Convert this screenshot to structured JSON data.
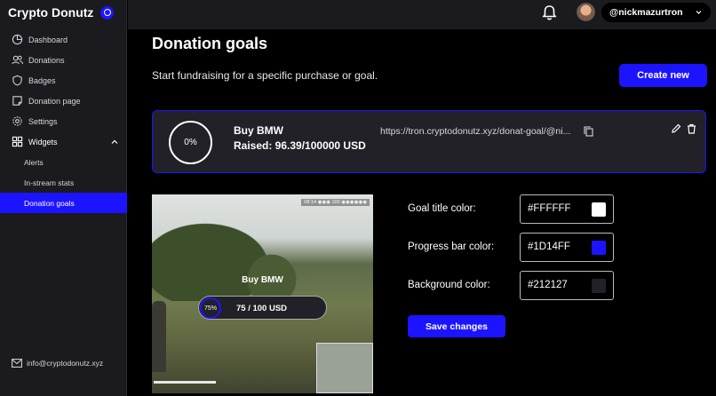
{
  "app": {
    "title": "Crypto Donutz"
  },
  "sidebar": {
    "items": [
      {
        "label": "Dashboard",
        "icon": "dashboard-icon"
      },
      {
        "label": "Donations",
        "icon": "users-icon"
      },
      {
        "label": "Badges",
        "icon": "shield-icon"
      },
      {
        "label": "Donation page",
        "icon": "page-icon"
      },
      {
        "label": "Settings",
        "icon": "gear-icon"
      },
      {
        "label": "Widgets",
        "icon": "grid-icon",
        "expanded": true
      }
    ],
    "widgets_sub": [
      {
        "label": "Alerts",
        "active": false
      },
      {
        "label": "In-stream stats",
        "active": false
      },
      {
        "label": "Donation goals",
        "active": true
      }
    ],
    "contact_email": "info@cryptodonutz.xyz"
  },
  "header": {
    "username": "@nickmazurtron"
  },
  "main": {
    "title": "Donation goals",
    "subtitle": "Start fundraising for a specific purchase or goal.",
    "create_label": "Create new",
    "goal": {
      "percent": "0%",
      "name": "Buy BMW",
      "raised": "Raised: 96.39/100000 USD",
      "url": "https://tron.cryptodonutz.xyz/donat-goal/@ni..."
    },
    "preview": {
      "hud_text": "08:14 ◉◉◉  100 ◉◉◉◉◉◉",
      "title": "Buy BMW",
      "percent": "75%",
      "amount": "75 / 100 USD"
    },
    "colors": {
      "goal_title_label": "Goal title color:",
      "goal_title_value": "#FFFFFF",
      "progress_label": "Progress bar color:",
      "progress_value": "#1D14FF",
      "background_label": "Background color:",
      "background_value": "#212127"
    },
    "save_label": "Save changes"
  },
  "theme": {
    "accent": "#1D14FF",
    "card": "#212127",
    "sidebar": "#1A1A1F"
  }
}
